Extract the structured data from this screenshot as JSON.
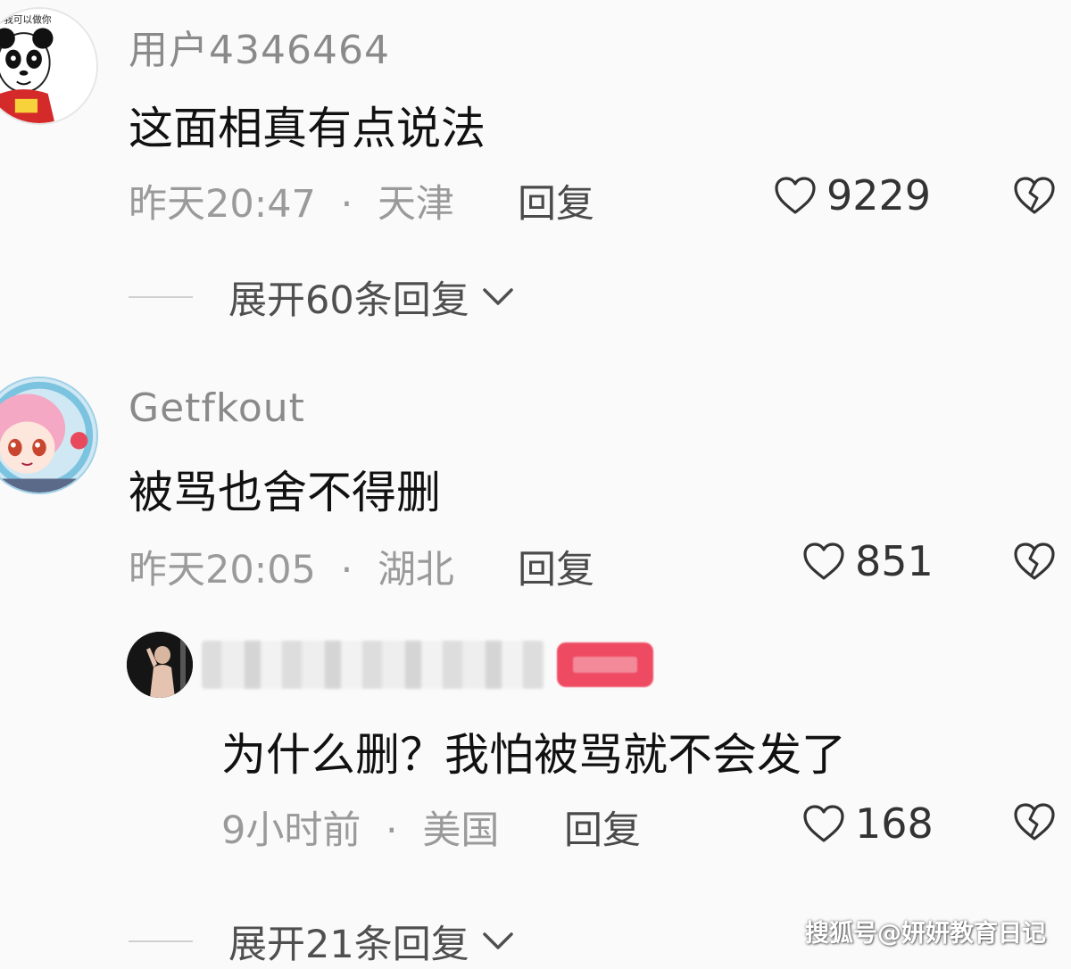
{
  "comments": [
    {
      "username": "用户4346464",
      "text": "这面相真有点说法",
      "time": "昨天20:47",
      "location": "天津",
      "reply_label": "回复",
      "likes": "9229"
    },
    {
      "username": "Getfkout",
      "text": "被骂也舍不得删",
      "time": "昨天20:05",
      "location": "湖北",
      "reply_label": "回复",
      "likes": "851",
      "replies": [
        {
          "text": "为什么删？我怕被骂就不会发了",
          "time": "9小时前",
          "location": "美国",
          "reply_label": "回复",
          "likes": "168"
        }
      ]
    }
  ],
  "expand_1": "展开60条回复",
  "expand_2": "展开21条回复",
  "separator": "·",
  "watermark": "搜狐号@妍妍教育日记",
  "icons": {
    "like": "heart-outline-icon",
    "dislike": "broken-heart-icon",
    "expand": "chevron-down-icon"
  },
  "colors": {
    "background": "#fafafa",
    "meta_text": "#9a9a9a",
    "badge": "#ee4b63"
  }
}
